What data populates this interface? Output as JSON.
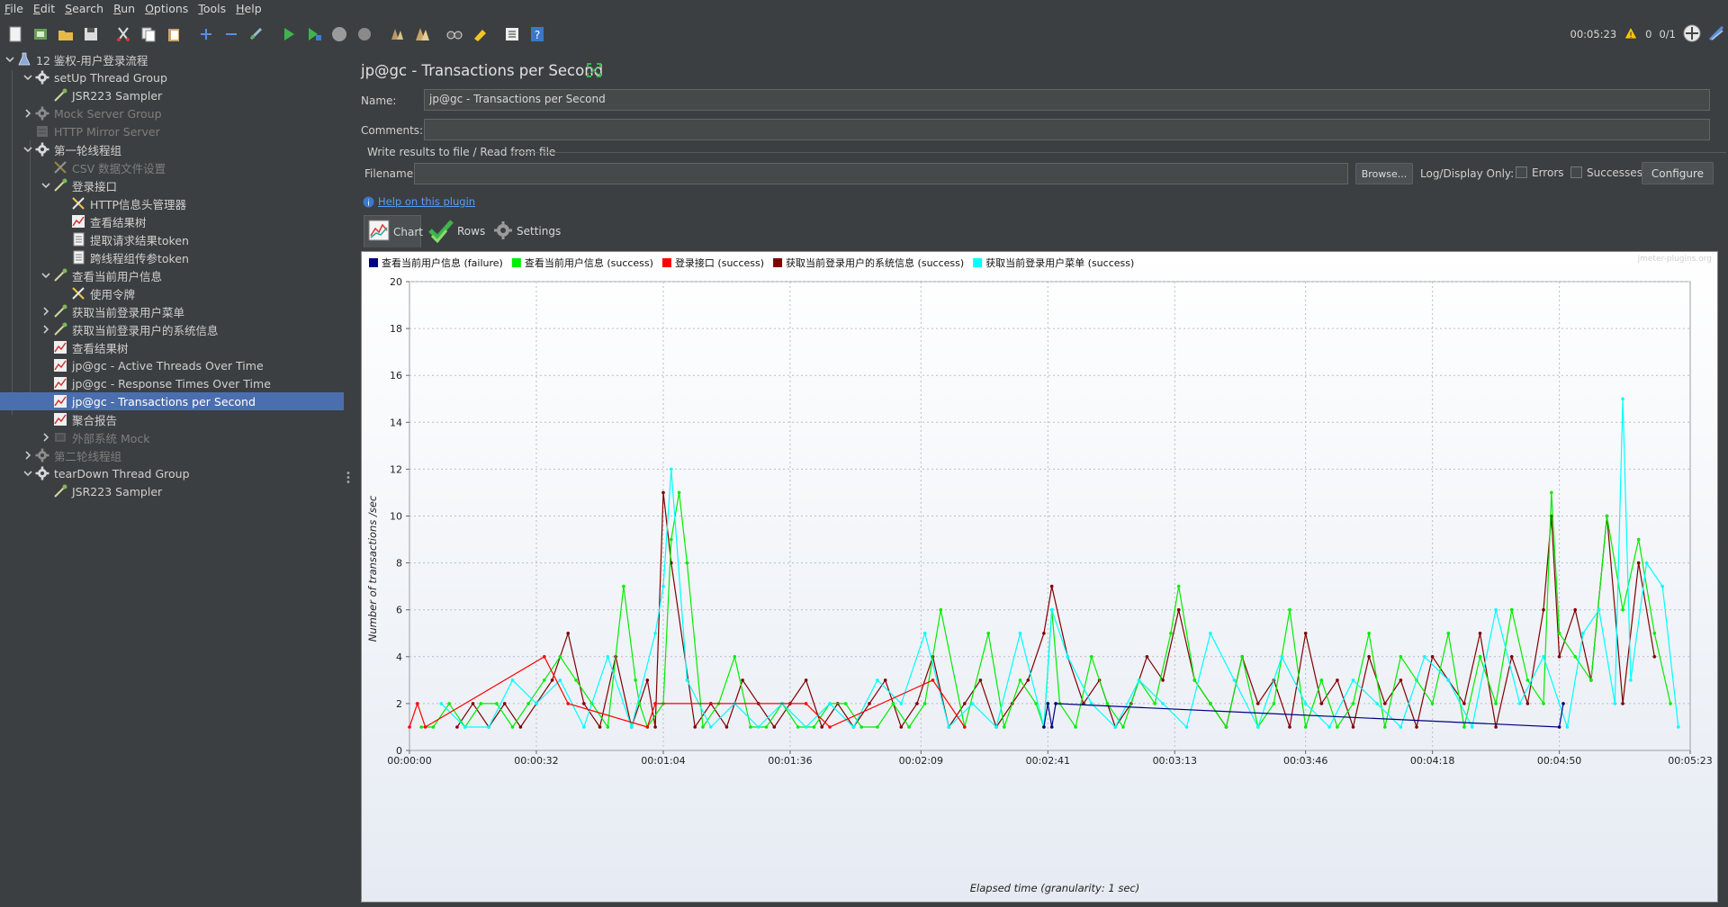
{
  "menu": [
    {
      "pre": "",
      "u": "F",
      "post": "ile"
    },
    {
      "pre": "",
      "u": "E",
      "post": "dit"
    },
    {
      "pre": "",
      "u": "S",
      "post": "earch"
    },
    {
      "pre": "",
      "u": "R",
      "post": "un"
    },
    {
      "pre": "",
      "u": "O",
      "post": "ptions"
    },
    {
      "pre": "",
      "u": "T",
      "post": "ools"
    },
    {
      "pre": "",
      "u": "H",
      "post": "elp"
    }
  ],
  "toolbar": {
    "timer": "00:05:23",
    "warning_count": "0",
    "thread_count": "0/1"
  },
  "tree": [
    {
      "label": "12 鉴权-用户登录流程",
      "icon": "test-plan-icon",
      "indent": 0,
      "chevron": "down",
      "disabled": false,
      "selected": false
    },
    {
      "label": "setUp Thread Group",
      "icon": "gear-icon",
      "indent": 1,
      "chevron": "down",
      "disabled": false,
      "selected": false
    },
    {
      "label": "JSR223 Sampler",
      "icon": "pipette-icon",
      "indent": 2,
      "chevron": "",
      "disabled": false,
      "selected": false
    },
    {
      "label": "Mock Server Group",
      "icon": "gear-icon",
      "indent": 1,
      "chevron": "right",
      "disabled": true,
      "selected": false
    },
    {
      "label": "HTTP Mirror Server",
      "icon": "server-icon",
      "indent": 1,
      "chevron": "",
      "disabled": true,
      "selected": false
    },
    {
      "label": "第一轮线程组",
      "icon": "gear-icon",
      "indent": 1,
      "chevron": "down",
      "disabled": false,
      "selected": false
    },
    {
      "label": "CSV 数据文件设置",
      "icon": "scissors-icon",
      "indent": 2,
      "chevron": "",
      "disabled": true,
      "selected": false
    },
    {
      "label": "登录接口",
      "icon": "pipette-icon",
      "indent": 2,
      "chevron": "down",
      "disabled": false,
      "selected": false
    },
    {
      "label": "HTTP信息头管理器",
      "icon": "scissors-icon",
      "indent": 3,
      "chevron": "",
      "disabled": false,
      "selected": false
    },
    {
      "label": "查看结果树",
      "icon": "listener-icon",
      "indent": 3,
      "chevron": "",
      "disabled": false,
      "selected": false
    },
    {
      "label": "提取请求结果token",
      "icon": "document-icon",
      "indent": 3,
      "chevron": "",
      "disabled": false,
      "selected": false
    },
    {
      "label": "跨线程组传参token",
      "icon": "document-icon",
      "indent": 3,
      "chevron": "",
      "disabled": false,
      "selected": false
    },
    {
      "label": "查看当前用户信息",
      "icon": "pipette-icon",
      "indent": 2,
      "chevron": "down",
      "disabled": false,
      "selected": false
    },
    {
      "label": "使用令牌",
      "icon": "scissors-icon",
      "indent": 3,
      "chevron": "",
      "disabled": false,
      "selected": false
    },
    {
      "label": "获取当前登录用户菜单",
      "icon": "pipette-icon",
      "indent": 2,
      "chevron": "right",
      "disabled": false,
      "selected": false
    },
    {
      "label": "获取当前登录用户的系统信息",
      "icon": "pipette-icon",
      "indent": 2,
      "chevron": "right",
      "disabled": false,
      "selected": false
    },
    {
      "label": "查看结果树",
      "icon": "listener-icon",
      "indent": 2,
      "chevron": "",
      "disabled": false,
      "selected": false
    },
    {
      "label": "jp@gc - Active Threads Over Time",
      "icon": "listener-icon",
      "indent": 2,
      "chevron": "",
      "disabled": false,
      "selected": false
    },
    {
      "label": "jp@gc - Response Times Over Time",
      "icon": "listener-icon",
      "indent": 2,
      "chevron": "",
      "disabled": false,
      "selected": false
    },
    {
      "label": "jp@gc - Transactions per Second",
      "icon": "listener-icon",
      "indent": 2,
      "chevron": "",
      "disabled": false,
      "selected": true
    },
    {
      "label": "聚合报告",
      "icon": "listener-icon",
      "indent": 2,
      "chevron": "",
      "disabled": false,
      "selected": false
    },
    {
      "label": "外部系统 Mock",
      "icon": "controller-icon",
      "indent": 2,
      "chevron": "right",
      "disabled": true,
      "selected": false
    },
    {
      "label": "第二轮线程组",
      "icon": "gear-icon",
      "indent": 1,
      "chevron": "right",
      "disabled": true,
      "selected": false
    },
    {
      "label": "tearDown Thread Group",
      "icon": "gear-icon",
      "indent": 1,
      "chevron": "down",
      "disabled": false,
      "selected": false
    },
    {
      "label": "JSR223 Sampler",
      "icon": "pipette-icon",
      "indent": 2,
      "chevron": "",
      "disabled": false,
      "selected": false
    }
  ],
  "panel": {
    "title": "jp@gc - Transactions per Second",
    "name_label": "Name:",
    "name_value": "jp@gc - Transactions per Second",
    "comments_label": "Comments:",
    "comments_value": "",
    "file_section_label": "Write results to file / Read from file",
    "filename_label": "Filename",
    "filename_value": "",
    "browse_label": "Browse...",
    "log_display_label": "Log/Display Only:",
    "errors_label": "Errors",
    "successes_label": "Successes",
    "configure_label": "Configure",
    "help_link": "Help on this plugin",
    "tabs": [
      {
        "label": "Chart",
        "icon": "chart-icon",
        "active": true
      },
      {
        "label": "Rows",
        "icon": "checkmark-icon",
        "active": false
      },
      {
        "label": "Settings",
        "icon": "gear-icon",
        "active": false
      }
    ],
    "watermark": "jmeter-plugins.org"
  },
  "colors": {
    "background": "#3c3f41",
    "selection": "#4b6eaf",
    "link": "#589df6"
  },
  "chart_data": {
    "type": "line",
    "xlabel": "Elapsed time (granularity: 1 sec)",
    "ylabel": "Number of transactions /sec",
    "ylim": [
      0,
      20
    ],
    "xlim": [
      0,
      323
    ],
    "x_ticks": [
      {
        "t": 0,
        "label": "00:00:00"
      },
      {
        "t": 32,
        "label": "00:00:32"
      },
      {
        "t": 64,
        "label": "00:01:04"
      },
      {
        "t": 96,
        "label": "00:01:36"
      },
      {
        "t": 129,
        "label": "00:02:09"
      },
      {
        "t": 161,
        "label": "00:02:41"
      },
      {
        "t": 193,
        "label": "00:03:13"
      },
      {
        "t": 226,
        "label": "00:03:46"
      },
      {
        "t": 258,
        "label": "00:04:18"
      },
      {
        "t": 290,
        "label": "00:04:50"
      },
      {
        "t": 323,
        "label": "00:05:23"
      }
    ],
    "y_ticks": [
      0,
      2,
      4,
      6,
      8,
      10,
      12,
      14,
      16,
      18,
      20
    ],
    "grid": true,
    "legend_position": "top-left",
    "series": [
      {
        "name": "查看当前用户信息 (failure)",
        "color": "#000080",
        "x": [
          160,
          161,
          162,
          163,
          290,
          291
        ],
        "y": [
          1,
          2,
          1,
          2,
          1,
          2
        ]
      },
      {
        "name": "查看当前用户信息 (success)",
        "color": "#00ee00",
        "x": [
          3,
          6,
          10,
          14,
          18,
          22,
          26,
          30,
          34,
          38,
          42,
          46,
          50,
          54,
          57,
          58,
          60,
          64,
          66,
          68,
          70,
          74,
          78,
          82,
          86,
          90,
          94,
          98,
          102,
          106,
          110,
          114,
          118,
          122,
          126,
          130,
          134,
          140,
          146,
          150,
          154,
          158,
          160,
          162,
          164,
          168,
          172,
          176,
          180,
          184,
          188,
          192,
          194,
          198,
          202,
          206,
          210,
          214,
          218,
          222,
          226,
          230,
          234,
          238,
          242,
          246,
          250,
          254,
          258,
          262,
          266,
          270,
          274,
          278,
          282,
          286,
          288,
          290,
          294,
          298,
          302,
          306,
          310,
          314,
          318
        ],
        "y": [
          1,
          1,
          2,
          1,
          2,
          2,
          1,
          2,
          3,
          4,
          3,
          2,
          1,
          7,
          3,
          2,
          1,
          2,
          9,
          11,
          8,
          1,
          2,
          4,
          1,
          1,
          2,
          1,
          1,
          2,
          2,
          1,
          1,
          2,
          1,
          2,
          6,
          1,
          5,
          1,
          3,
          2,
          1,
          6,
          2,
          1,
          4,
          2,
          1,
          3,
          2,
          5,
          7,
          3,
          2,
          1,
          4,
          1,
          2,
          6,
          1,
          3,
          1,
          2,
          5,
          1,
          4,
          3,
          2,
          5,
          1,
          4,
          2,
          6,
          3,
          2,
          11,
          5,
          4,
          3,
          10,
          6,
          9,
          5,
          2
        ]
      },
      {
        "name": "登录接口 (success)",
        "color": "#ff0000",
        "x": [
          0,
          2,
          4,
          34,
          40,
          60,
          62,
          100,
          106,
          132,
          140
        ],
        "y": [
          1,
          2,
          1,
          4,
          2,
          1,
          2,
          2,
          1,
          3,
          1
        ]
      },
      {
        "name": "获取当前登录用户的系统信息 (success)",
        "color": "#800000",
        "x": [
          12,
          16,
          20,
          24,
          28,
          32,
          36,
          40,
          44,
          48,
          52,
          56,
          60,
          62,
          64,
          66,
          72,
          76,
          80,
          84,
          88,
          92,
          96,
          100,
          104,
          108,
          112,
          116,
          120,
          124,
          128,
          132,
          136,
          140,
          144,
          148,
          152,
          156,
          160,
          162,
          166,
          170,
          174,
          178,
          182,
          186,
          190,
          194,
          198,
          202,
          206,
          210,
          214,
          218,
          222,
          226,
          230,
          234,
          238,
          242,
          246,
          250,
          254,
          258,
          262,
          266,
          270,
          274,
          278,
          282,
          286,
          288,
          290,
          294,
          298,
          302,
          306,
          310,
          314
        ],
        "y": [
          1,
          2,
          1,
          2,
          1,
          2,
          3,
          5,
          2,
          1,
          4,
          1,
          3,
          1,
          11,
          8,
          1,
          2,
          1,
          3,
          2,
          1,
          2,
          3,
          1,
          2,
          1,
          2,
          3,
          1,
          2,
          4,
          1,
          2,
          3,
          1,
          2,
          3,
          5,
          7,
          4,
          2,
          3,
          1,
          2,
          4,
          3,
          6,
          3,
          2,
          1,
          4,
          2,
          3,
          1,
          5,
          2,
          3,
          1,
          4,
          2,
          3,
          1,
          4,
          3,
          2,
          5,
          1,
          4,
          2,
          6,
          10,
          4,
          6,
          3,
          10,
          2,
          8,
          4
        ]
      },
      {
        "name": "获取当前登录用户菜单 (success)",
        "color": "#00ffff",
        "x": [
          8,
          14,
          20,
          26,
          32,
          38,
          44,
          50,
          56,
          62,
          64,
          66,
          70,
          76,
          82,
          88,
          94,
          100,
          106,
          112,
          118,
          124,
          130,
          136,
          142,
          148,
          154,
          160,
          162,
          166,
          172,
          178,
          184,
          190,
          196,
          202,
          208,
          214,
          220,
          226,
          232,
          238,
          244,
          250,
          256,
          262,
          268,
          274,
          280,
          286,
          292,
          296,
          300,
          304,
          306,
          308,
          312,
          316,
          320
        ],
        "y": [
          2,
          1,
          1,
          3,
          2,
          3,
          1,
          4,
          1,
          5,
          7,
          12,
          3,
          1,
          2,
          1,
          2,
          1,
          2,
          1,
          3,
          2,
          5,
          1,
          2,
          1,
          5,
          1,
          6,
          4,
          2,
          1,
          3,
          2,
          1,
          5,
          3,
          1,
          4,
          2,
          1,
          3,
          2,
          1,
          4,
          3,
          1,
          6,
          2,
          4,
          1,
          5,
          6,
          2,
          15,
          3,
          8,
          7,
          1
        ]
      }
    ]
  }
}
